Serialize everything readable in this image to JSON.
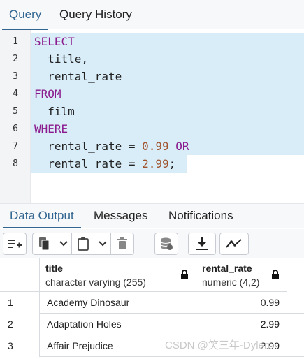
{
  "top_tabs": [
    {
      "label": "Query",
      "active": true
    },
    {
      "label": "Query History",
      "active": false
    }
  ],
  "editor": {
    "line_numbers": [
      "1",
      "2",
      "3",
      "4",
      "5",
      "6",
      "7",
      "8"
    ],
    "selection_color": "#d9edf8",
    "keyword_color": "#8a1a8d",
    "number_color": "#a0522d",
    "lines": [
      {
        "kw1": "SELECT"
      },
      {
        "indent": "  ",
        "text": "title,"
      },
      {
        "indent": "  ",
        "text": "rental_rate"
      },
      {
        "kw1": "FROM"
      },
      {
        "indent": "  ",
        "text": "film"
      },
      {
        "kw1": "WHERE"
      },
      {
        "indent": "  ",
        "text": "rental_rate = ",
        "num": "0.99",
        "kw2": " OR"
      },
      {
        "indent": "  ",
        "text": "rental_rate = ",
        "num": "2.99",
        "tail": ";"
      }
    ]
  },
  "lower_tabs": [
    {
      "label": "Data Output",
      "active": true
    },
    {
      "label": "Messages",
      "active": false
    },
    {
      "label": "Notifications",
      "active": false
    }
  ],
  "toolbar": {
    "buttons": [
      "add-row-icon",
      "copy-icon",
      "chevron-down-icon",
      "paste-icon",
      "chevron-down-icon",
      "trash-icon",
      "save-data-icon",
      "download-icon",
      "graph-icon"
    ]
  },
  "grid": {
    "columns": [
      {
        "name": "title",
        "type": "character varying (255)"
      },
      {
        "name": "rental_rate",
        "type": "numeric (4,2)"
      }
    ],
    "rows": [
      {
        "n": "1",
        "title": "Academy Dinosaur",
        "rate": "0.99"
      },
      {
        "n": "2",
        "title": "Adaptation Holes",
        "rate": "2.99"
      },
      {
        "n": "3",
        "title": "Affair Prejudice",
        "rate": "2.99"
      }
    ]
  },
  "watermark": "CSDN @笑三年-Dylen"
}
